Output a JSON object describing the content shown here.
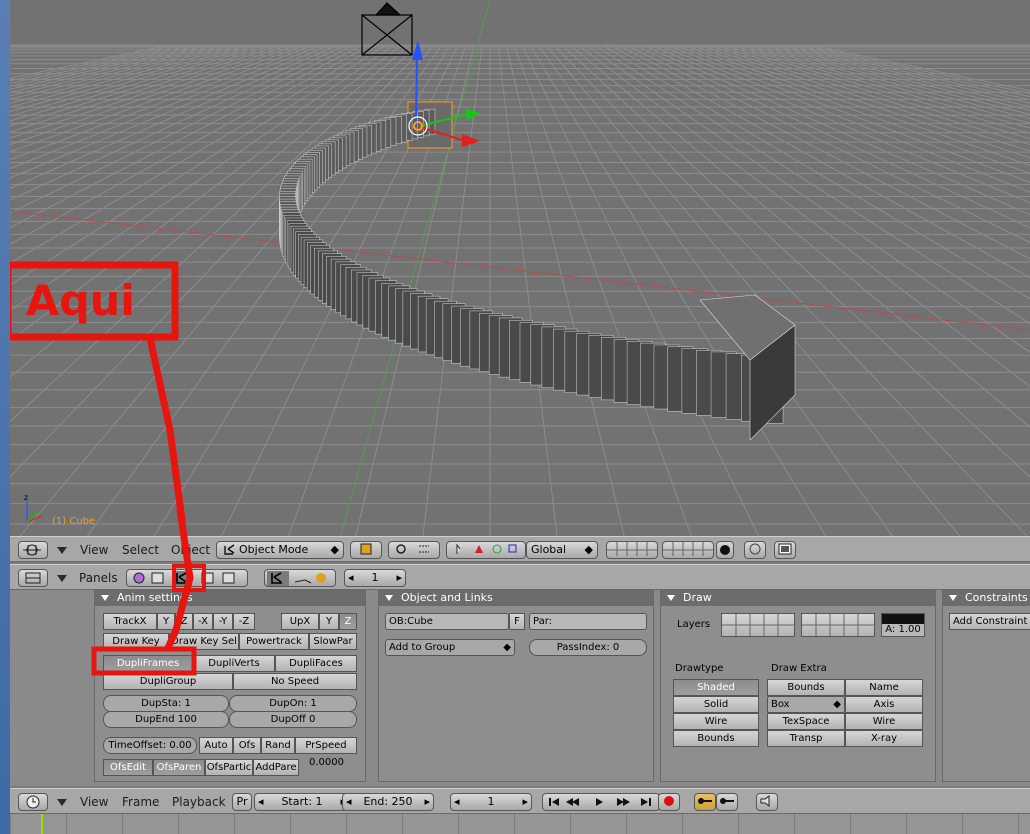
{
  "viewport": {
    "object_label": "(1) Cube",
    "annotation_text": "Aqui",
    "colors": {
      "background": "#727272",
      "grid": "#8a8a8a",
      "annotation": "#e8150f",
      "selection": "#ff9a1f",
      "axis_x": "#e02020",
      "axis_y": "#18c418",
      "axis_z": "#2552ff"
    }
  },
  "view3d_header": {
    "menu_view": "View",
    "menu_select": "Select",
    "menu_object": "Object",
    "mode_select": "Object Mode",
    "orientation_select": "Global"
  },
  "buttons_header": {
    "panels_label": "Panels",
    "frame_value": "1"
  },
  "anim_panel": {
    "title": "Anim settings",
    "track_x": "TrackX",
    "track_y": "Y",
    "track_z": "Z",
    "track_nx": "-X",
    "track_ny": "-Y",
    "track_nz": "-Z",
    "up_x": "UpX",
    "up_y": "Y",
    "up_z": "Z",
    "draw_key": "Draw Key",
    "draw_key_sel": "Draw Key Sel",
    "powertrack": "Powertrack",
    "slow_par": "SlowPar",
    "dupli_frames": "DupliFrames",
    "dupli_verts": "DupliVerts",
    "dupli_faces": "DupliFaces",
    "dupli_group": "DupliGroup",
    "no_speed": "No Speed",
    "dup_sta": "DupSta: 1",
    "dup_on": "DupOn: 1",
    "dup_end": "DupEnd 100",
    "dup_off": "DupOff 0",
    "time_offset": "TimeOffset: 0.00",
    "auto": "Auto",
    "ofs": "Ofs",
    "rand": "Rand",
    "pr_speed": "PrSpeed",
    "ofs_edit": "OfsEdit",
    "ofs_paren": "OfsParen",
    "ofs_partic": "OfsPartic",
    "add_pare": "AddPare",
    "value_readout": "0.0000"
  },
  "object_panel": {
    "title": "Object and Links",
    "ob_name": "OB:Cube",
    "f_button": "F",
    "par_field": "Par:",
    "add_to_group": "Add to Group",
    "pass_index": "PassIndex: 0"
  },
  "draw_panel": {
    "title": "Draw",
    "layers_label": "Layers",
    "alpha_value": "A: 1.00",
    "drawtype_label": "Drawtype",
    "draw_extra_label": "Draw Extra",
    "drawtypes": [
      "Shaded",
      "Solid",
      "Wire",
      "Bounds"
    ],
    "extra_left": [
      "Bounds",
      "Box",
      "TexSpace",
      "Transp"
    ],
    "extra_right": [
      "Name",
      "Axis",
      "Wire",
      "X-ray"
    ]
  },
  "constraints_panel": {
    "title": "Constraints",
    "add_constraint": "Add Constraint"
  },
  "timeline_header": {
    "menu_view": "View",
    "menu_frame": "Frame",
    "menu_playback": "Playback",
    "pr_button": "Pr",
    "start_field": "Start: 1",
    "end_field": "End: 250",
    "current_frame": "1"
  }
}
